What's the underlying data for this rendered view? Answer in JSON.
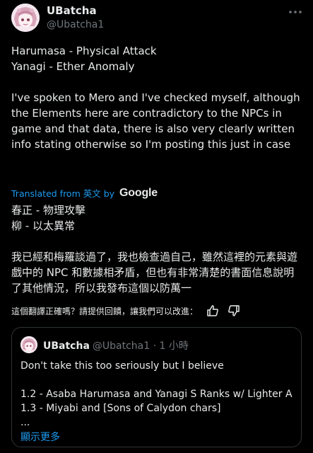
{
  "author": {
    "display_name": "UBatcha",
    "handle": "@Ubatcha1"
  },
  "tweet": {
    "text": "Harumasa - Physical Attack\nYanagi - Ether Anomaly\n\nI've spoken to Mero and I've checked myself, although the Elements here are contradictory to the NPCs in game and that data, there is also very clearly written info stating otherwise so I'm posting this just in case"
  },
  "translation": {
    "label": "Translated from 英文 by",
    "provider": "Google",
    "text": "春正 - 物理攻擊\n柳 - 以太異常\n\n我已經和梅羅談過了，我也檢查過自己，雖然這裡的元素與遊戲中的 NPC 和數據相矛盾，但也有非常清楚的書面信息說明了其他情況，所以我發布這個以防萬一",
    "feedback_prompt": "這個翻譯正確嗎？請提供回饋，讓我們可以改進："
  },
  "quote": {
    "display_name": "UBatcha",
    "meta": "@Ubatcha1 · 1 小時",
    "text": "Don't take this too seriously but I believe\n\n1.2 - Asaba Harumasa and Yanagi S Ranks w/ Lighter A\n1.3 - Miyabi and [Sons of Calydon chars]\n...",
    "show_more": "顯示更多"
  },
  "colors": {
    "background": "#000000",
    "text": "#e7e9ea",
    "secondary": "#71767b",
    "link": "#1d9bf0",
    "border": "#2f3336"
  }
}
